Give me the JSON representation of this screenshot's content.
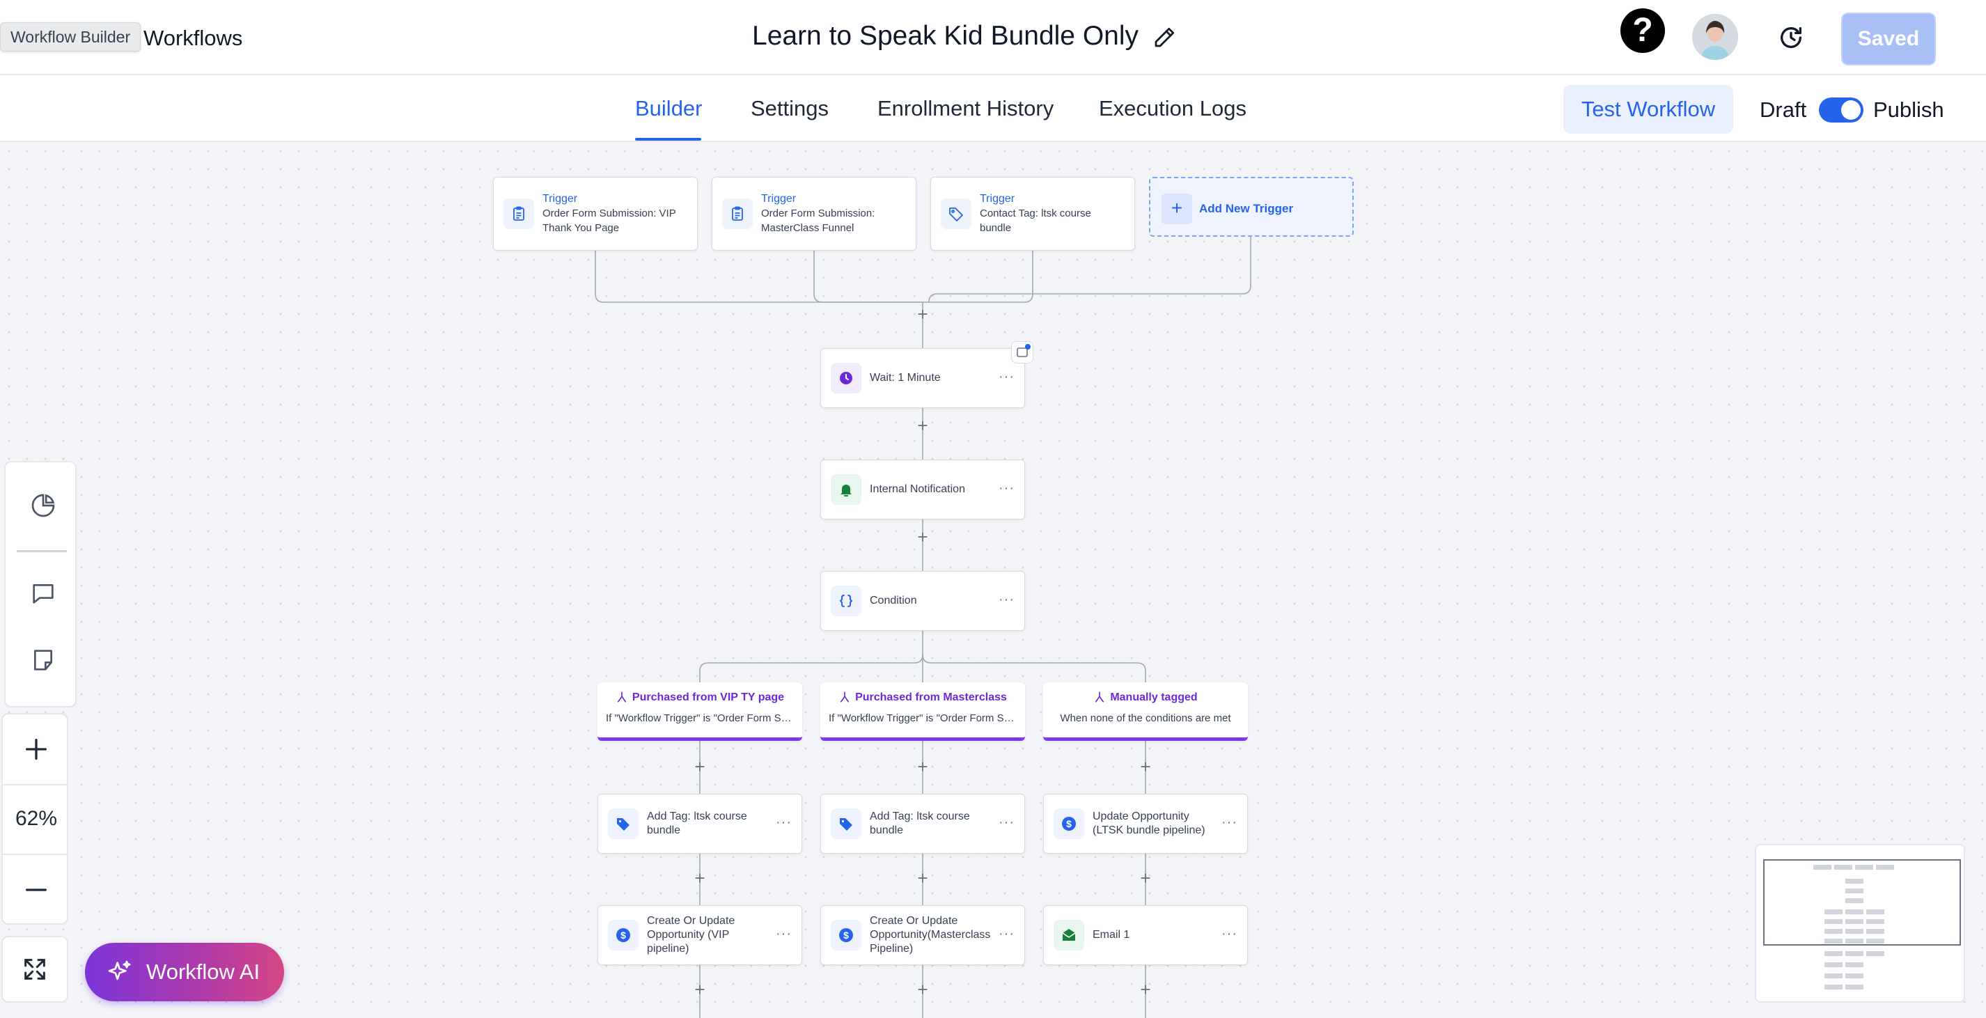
{
  "header": {
    "tooltip": "Workflow Builder",
    "back_label": "Workflows",
    "title": "Learn to Speak Kid Bundle Only",
    "help_label": "?",
    "saved_label": "Saved"
  },
  "tabs": [
    {
      "label": "Builder",
      "active": true
    },
    {
      "label": "Settings",
      "active": false
    },
    {
      "label": "Enrollment History",
      "active": false
    },
    {
      "label": "Execution Logs",
      "active": false
    }
  ],
  "actions": {
    "test_label": "Test Workflow",
    "draft_label": "Draft",
    "publish_label": "Publish",
    "publish_toggle_on": true
  },
  "triggers": [
    {
      "kind": "Trigger",
      "text": "Order Form Submission: VIP Thank You Page",
      "icon": "form-icon"
    },
    {
      "kind": "Trigger",
      "text": "Order Form Submission: MasterClass Funnel",
      "icon": "form-icon"
    },
    {
      "kind": "Trigger",
      "text": "Contact Tag: ltsk course bundle",
      "icon": "tag-icon"
    }
  ],
  "add_trigger_label": "Add New Trigger",
  "steps": [
    {
      "label": "Wait: 1 Minute",
      "icon": "clock-icon"
    },
    {
      "label": "Internal Notification",
      "icon": "bell-icon"
    },
    {
      "label": "Condition",
      "icon": "braces-icon"
    }
  ],
  "branches": [
    {
      "name": "Purchased from VIP TY page",
      "desc": "If \"Workflow Trigger\" is \"Order Form Submission: VIP Thank You Page\"",
      "actions": [
        {
          "label": "Add Tag: ltsk course bundle",
          "icon": "tag-icon"
        },
        {
          "label": "Create Or Update Opportunity (VIP pipeline)",
          "icon": "dollar-icon"
        }
      ]
    },
    {
      "name": "Purchased from Masterclass",
      "desc": "If \"Workflow Trigger\" is \"Order Form Submission: MasterClass Funnel\"",
      "actions": [
        {
          "label": "Add Tag: ltsk course bundle",
          "icon": "tag-icon"
        },
        {
          "label": "Create Or Update Opportunity(Masterclass Pipeline)",
          "icon": "dollar-icon"
        }
      ]
    },
    {
      "name": "Manually tagged",
      "desc": "When none of the conditions are met",
      "actions": [
        {
          "label": "Update Opportunity (LTSK bundle pipeline)",
          "icon": "dollar-icon"
        },
        {
          "label": "Email 1",
          "icon": "email-icon"
        }
      ]
    }
  ],
  "zoom": {
    "value": "62%"
  },
  "ai_button_label": "Workflow AI",
  "colors": {
    "primary": "#2563eb",
    "branch_accent": "#7c3aed",
    "saved_bg": "#a9c0f7",
    "canvas_bg": "#f3f4f7"
  }
}
